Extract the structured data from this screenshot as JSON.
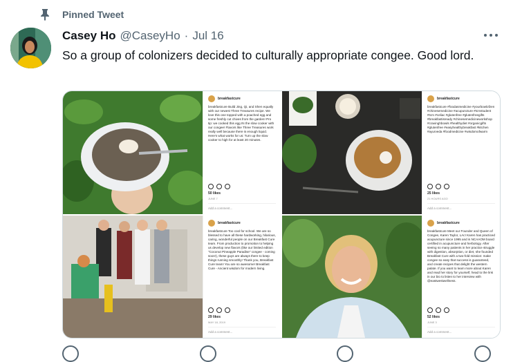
{
  "pinned": {
    "label": "Pinned Tweet"
  },
  "tweet": {
    "name": "Casey Ho",
    "handle": "@CaseyHo",
    "separator": "·",
    "date": "Jul 16",
    "text": "So a group of colonizers decided to culturally appropriate congee. Good lord."
  },
  "media": {
    "posts": [
      {
        "user": "breakfastcure",
        "caption": "breakfastcure Build Jing, Qi, and Shen equally with our newest Three Treasures recipe. We love this one topped with a poached egg and some freshly cut chives from the garden! Pro tip: we cooked this egg IN the slow cooker with our congee! Flavors like Three Treasures work really well because there is enough liquid. Here's what works for us: Turn up the slow cooker to high for at least 20 minutes.",
        "likes": "50 likes",
        "date": "JUNE 7",
        "comment": "Add a comment..."
      },
      {
        "user": "breakfastcure",
        "caption": "breakfastcure #foodasmedicine #yourbowlofzen #chinesemedicine #acupuncture #tcmstudent #tcm #celiac #glutenfree #glutenfreegifts #breakfastisready #chinesemedicineworkshop #cravinghbowls #healthydiet #organicgifts #glutenfree #easyhealthybreakfast #kitchen #ayurveda #foodmedicine #wisdomofwarm",
        "likes": "25 likes",
        "date": "21 HOURS AGO",
        "comment": "Add a comment..."
      },
      {
        "user": "breakfastcure",
        "caption": "breakfastcure Too cool for school. We are so blessed to have all these hardworking, hilarious, caring, wonderful people on our Breakfast Cure team. From production to promotion to helping us develop new flavors (like our limited edition \"Coconut Pineapple Paradise\" congee - coming soon!), these guys are always there to keep things running smoothly! Thank you, Breakfast Cure team! You are so awesome! Breakfast Cure - Ancient wisdom for modern living.",
        "likes": "29 likes",
        "date": "MAY 18, 2019",
        "comment": "Add a comment..."
      },
      {
        "user": "breakfastcure",
        "caption": "breakfastcure Meet our Founder and Queen of Congee, Karen Taylor, LAc! Karen has practiced acupuncture since 1995 and is NCAAOM board certified in acupuncture and herbology. After seeing so many patients in her practice struggle with digestion, absorption, or diet, she founded Breakfast Cure with a two-fold mission: make congee so easy that success is guaranteed, and create recipes that delight the western palate. If you want to learn more about Karen and read her story for yourself, head to the link in our bio to listen to her interview with @eastwestwellness.",
        "likes": "52 likes",
        "date": "JUNE 3",
        "comment": "Add a comment..."
      }
    ]
  },
  "colors": {
    "text": "#0f1419",
    "secondary": "#536471",
    "border": "#cfd9de"
  }
}
